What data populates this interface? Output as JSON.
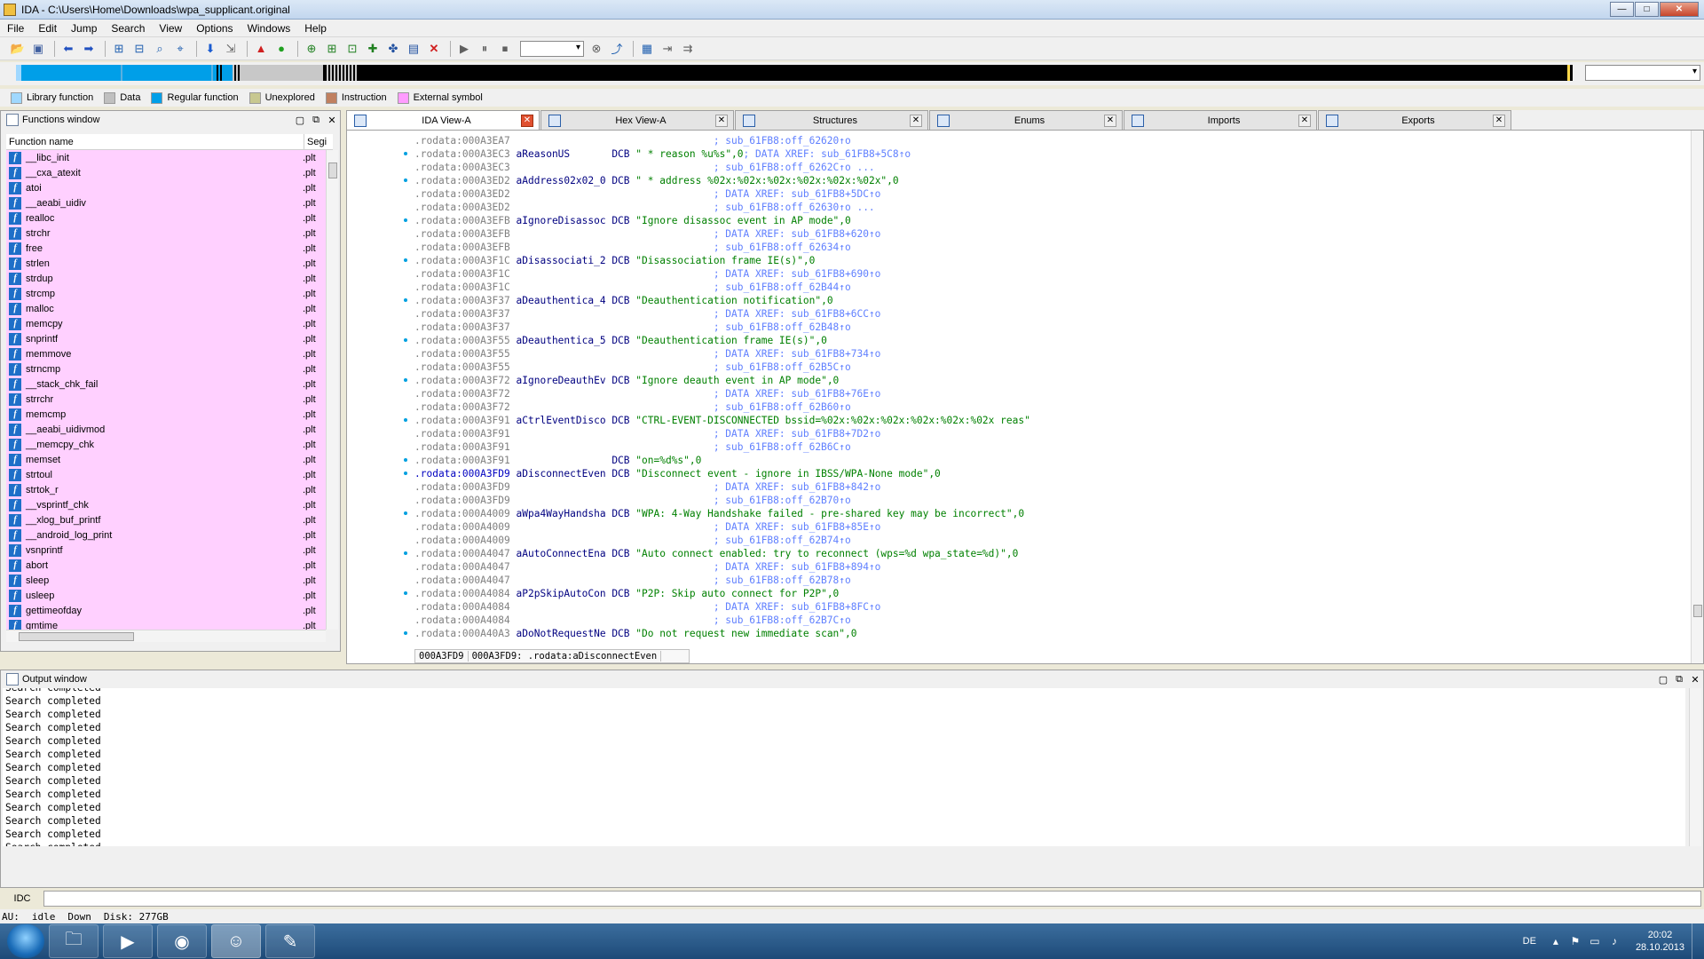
{
  "window": {
    "title": "IDA - C:\\Users\\Home\\Downloads\\wpa_supplicant.original",
    "buttons": {
      "minimize": "—",
      "maximize": "□",
      "close": "✕"
    }
  },
  "menu": [
    "File",
    "Edit",
    "Jump",
    "Search",
    "View",
    "Options",
    "Windows",
    "Help"
  ],
  "toolbar_icons": [
    "open-icon",
    "save-icon",
    "back-icon",
    "forward-icon",
    "search-icon",
    "go-icon",
    "run-icon",
    "pause-icon",
    "stop-icon",
    "debugger-select",
    "close-icon"
  ],
  "legend": [
    {
      "label": "Library function",
      "color": "#a0d8ff"
    },
    {
      "label": "Data",
      "color": "#c0c0c0"
    },
    {
      "label": "Regular function",
      "color": "#009fe8"
    },
    {
      "label": "Unexplored",
      "color": "#c8c890"
    },
    {
      "label": "Instruction",
      "color": "#c08060"
    },
    {
      "label": "External symbol",
      "color": "#ff9cff"
    }
  ],
  "functions_window": {
    "title": "Functions window",
    "col_name": "Function name",
    "col_seg": "Segi",
    "functions": [
      {
        "name": "__libc_init",
        "seg": ".plt"
      },
      {
        "name": "__cxa_atexit",
        "seg": ".plt"
      },
      {
        "name": "atoi",
        "seg": ".plt"
      },
      {
        "name": "__aeabi_uidiv",
        "seg": ".plt"
      },
      {
        "name": "realloc",
        "seg": ".plt"
      },
      {
        "name": "strchr",
        "seg": ".plt"
      },
      {
        "name": "free",
        "seg": ".plt"
      },
      {
        "name": "strlen",
        "seg": ".plt"
      },
      {
        "name": "strdup",
        "seg": ".plt"
      },
      {
        "name": "strcmp",
        "seg": ".plt"
      },
      {
        "name": "malloc",
        "seg": ".plt"
      },
      {
        "name": "memcpy",
        "seg": ".plt"
      },
      {
        "name": "snprintf",
        "seg": ".plt"
      },
      {
        "name": "memmove",
        "seg": ".plt"
      },
      {
        "name": "strncmp",
        "seg": ".plt"
      },
      {
        "name": "__stack_chk_fail",
        "seg": ".plt"
      },
      {
        "name": "strrchr",
        "seg": ".plt"
      },
      {
        "name": "memcmp",
        "seg": ".plt"
      },
      {
        "name": "__aeabi_uidivmod",
        "seg": ".plt"
      },
      {
        "name": "__memcpy_chk",
        "seg": ".plt"
      },
      {
        "name": "memset",
        "seg": ".plt"
      },
      {
        "name": "strtoul",
        "seg": ".plt"
      },
      {
        "name": "strtok_r",
        "seg": ".plt"
      },
      {
        "name": "__vsprintf_chk",
        "seg": ".plt"
      },
      {
        "name": "__xlog_buf_printf",
        "seg": ".plt"
      },
      {
        "name": "__android_log_print",
        "seg": ".plt"
      },
      {
        "name": "vsnprintf",
        "seg": ".plt"
      },
      {
        "name": "abort",
        "seg": ".plt"
      },
      {
        "name": "sleep",
        "seg": ".plt"
      },
      {
        "name": "usleep",
        "seg": ".plt"
      },
      {
        "name": "gettimeofday",
        "seg": ".plt"
      },
      {
        "name": "gmtime",
        "seg": ".plt"
      }
    ]
  },
  "tabs": [
    {
      "label": "IDA View-A",
      "active": true
    },
    {
      "label": "Hex View-A",
      "active": false
    },
    {
      "label": "Structures",
      "active": false
    },
    {
      "label": "Enums",
      "active": false
    },
    {
      "label": "Imports",
      "active": false
    },
    {
      "label": "Exports",
      "active": false
    }
  ],
  "code_lines": [
    {
      "addr": ".rodata:000A3EA7",
      "name": "",
      "op": "",
      "arg": "",
      "comment": "; sub_61FB8:off_62620↑o"
    },
    {
      "addr": ".rodata:000A3EC3",
      "name": "aReasonUS",
      "op": "DCB",
      "arg": "\" * reason %u%s\",0",
      "comment": "; DATA XREF: sub_61FB8+5C8↑o"
    },
    {
      "addr": ".rodata:000A3EC3",
      "name": "",
      "op": "",
      "arg": "",
      "comment": "; sub_61FB8:off_6262C↑o ..."
    },
    {
      "addr": ".rodata:000A3ED2",
      "name": "aAddress02x02_0",
      "op": "DCB",
      "arg": "\" * address %02x:%02x:%02x:%02x:%02x:%02x\",0",
      "comment": ""
    },
    {
      "addr": ".rodata:000A3ED2",
      "name": "",
      "op": "",
      "arg": "",
      "comment": "; DATA XREF: sub_61FB8+5DC↑o"
    },
    {
      "addr": ".rodata:000A3ED2",
      "name": "",
      "op": "",
      "arg": "",
      "comment": "; sub_61FB8:off_62630↑o ..."
    },
    {
      "addr": ".rodata:000A3EFB",
      "name": "aIgnoreDisassoc",
      "op": "DCB",
      "arg": "\"Ignore disassoc event in AP mode\",0",
      "comment": ""
    },
    {
      "addr": ".rodata:000A3EFB",
      "name": "",
      "op": "",
      "arg": "",
      "comment": "; DATA XREF: sub_61FB8+620↑o"
    },
    {
      "addr": ".rodata:000A3EFB",
      "name": "",
      "op": "",
      "arg": "",
      "comment": "; sub_61FB8:off_62634↑o"
    },
    {
      "addr": ".rodata:000A3F1C",
      "name": "aDisassociati_2",
      "op": "DCB",
      "arg": "\"Disassociation frame IE(s)\",0",
      "comment": ""
    },
    {
      "addr": ".rodata:000A3F1C",
      "name": "",
      "op": "",
      "arg": "",
      "comment": "; DATA XREF: sub_61FB8+690↑o"
    },
    {
      "addr": ".rodata:000A3F1C",
      "name": "",
      "op": "",
      "arg": "",
      "comment": "; sub_61FB8:off_62B44↑o"
    },
    {
      "addr": ".rodata:000A3F37",
      "name": "aDeauthentica_4",
      "op": "DCB",
      "arg": "\"Deauthentication notification\",0",
      "comment": ""
    },
    {
      "addr": ".rodata:000A3F37",
      "name": "",
      "op": "",
      "arg": "",
      "comment": "; DATA XREF: sub_61FB8+6CC↑o"
    },
    {
      "addr": ".rodata:000A3F37",
      "name": "",
      "op": "",
      "arg": "",
      "comment": "; sub_61FB8:off_62B48↑o"
    },
    {
      "addr": ".rodata:000A3F55",
      "name": "aDeauthentica_5",
      "op": "DCB",
      "arg": "\"Deauthentication frame IE(s)\",0",
      "comment": ""
    },
    {
      "addr": ".rodata:000A3F55",
      "name": "",
      "op": "",
      "arg": "",
      "comment": "; DATA XREF: sub_61FB8+734↑o"
    },
    {
      "addr": ".rodata:000A3F55",
      "name": "",
      "op": "",
      "arg": "",
      "comment": "; sub_61FB8:off_62B5C↑o"
    },
    {
      "addr": ".rodata:000A3F72",
      "name": "aIgnoreDeauthEv",
      "op": "DCB",
      "arg": "\"Ignore deauth event in AP mode\",0",
      "comment": ""
    },
    {
      "addr": ".rodata:000A3F72",
      "name": "",
      "op": "",
      "arg": "",
      "comment": "; DATA XREF: sub_61FB8+76E↑o"
    },
    {
      "addr": ".rodata:000A3F72",
      "name": "",
      "op": "",
      "arg": "",
      "comment": "; sub_61FB8:off_62B60↑o"
    },
    {
      "addr": ".rodata:000A3F91",
      "name": "aCtrlEventDisco",
      "op": "DCB",
      "arg": "\"CTRL-EVENT-DISCONNECTED bssid=%02x:%02x:%02x:%02x:%02x:%02x reas\"",
      "comment": ""
    },
    {
      "addr": ".rodata:000A3F91",
      "name": "",
      "op": "",
      "arg": "",
      "comment": "; DATA XREF: sub_61FB8+7D2↑o"
    },
    {
      "addr": ".rodata:000A3F91",
      "name": "",
      "op": "",
      "arg": "",
      "comment": "; sub_61FB8:off_62B6C↑o"
    },
    {
      "addr": ".rodata:000A3F91",
      "name": "",
      "op": "DCB",
      "arg": "\"on=%d%s\",0",
      "comment": ""
    },
    {
      "addr": ".rodata:000A3FD9",
      "name": "aDisconnectEven",
      "op": "DCB",
      "arg": "\"Disconnect event - ignore in IBSS/WPA-None mode\",0",
      "comment": "",
      "highlight": true
    },
    {
      "addr": ".rodata:000A3FD9",
      "name": "",
      "op": "",
      "arg": "",
      "comment": "; DATA XREF: sub_61FB8+842↑o"
    },
    {
      "addr": ".rodata:000A3FD9",
      "name": "",
      "op": "",
      "arg": "",
      "comment": "; sub_61FB8:off_62B70↑o"
    },
    {
      "addr": ".rodata:000A4009",
      "name": "aWpa4WayHandsha",
      "op": "DCB",
      "arg": "\"WPA: 4-Way Handshake failed - pre-shared key may be incorrect\",0",
      "comment": ""
    },
    {
      "addr": ".rodata:000A4009",
      "name": "",
      "op": "",
      "arg": "",
      "comment": "; DATA XREF: sub_61FB8+85E↑o"
    },
    {
      "addr": ".rodata:000A4009",
      "name": "",
      "op": "",
      "arg": "",
      "comment": "; sub_61FB8:off_62B74↑o"
    },
    {
      "addr": ".rodata:000A4047",
      "name": "aAutoConnectEna",
      "op": "DCB",
      "arg": "\"Auto connect enabled: try to reconnect (wps=%d wpa_state=%d)\",0",
      "comment": ""
    },
    {
      "addr": ".rodata:000A4047",
      "name": "",
      "op": "",
      "arg": "",
      "comment": "; DATA XREF: sub_61FB8+894↑o"
    },
    {
      "addr": ".rodata:000A4047",
      "name": "",
      "op": "",
      "arg": "",
      "comment": "; sub_61FB8:off_62B78↑o"
    },
    {
      "addr": ".rodata:000A4084",
      "name": "aP2pSkipAutoCon",
      "op": "DCB",
      "arg": "\"P2P: Skip auto connect for P2P\",0",
      "comment": ""
    },
    {
      "addr": ".rodata:000A4084",
      "name": "",
      "op": "",
      "arg": "",
      "comment": "; DATA XREF: sub_61FB8+8FC↑o"
    },
    {
      "addr": ".rodata:000A4084",
      "name": "",
      "op": "",
      "arg": "",
      "comment": "; sub_61FB8:off_62B7C↑o"
    },
    {
      "addr": ".rodata:000A40A3",
      "name": "aDoNotRequestNe",
      "op": "DCB",
      "arg": "\"Do not request new immediate scan\",0",
      "comment": ""
    }
  ],
  "code_status": {
    "offset": "000A3FD9",
    "location": "000A3FD9: .rodata:aDisconnectEven"
  },
  "output_window": {
    "title": "Output window",
    "lines": [
      "Search completed",
      "Search completed",
      "Search completed",
      "Search completed",
      "Search completed",
      "Search completed",
      "Search completed",
      "Search completed",
      "Search completed",
      "Search completed",
      "Search completed",
      "Search completed",
      "Search completed",
      "Search completed",
      "Search completed"
    ]
  },
  "idc_label": "IDC",
  "statusbar": {
    "au": "AU:",
    "state": "idle",
    "direction": "Down",
    "disk": "Disk: 277GB"
  },
  "taskbar": {
    "apps": [
      "explorer-icon",
      "media-player-icon",
      "firefox-icon",
      "ida-icon",
      "paint-icon"
    ],
    "lang": "DE",
    "time": "20:02",
    "date": "28.10.2013"
  }
}
